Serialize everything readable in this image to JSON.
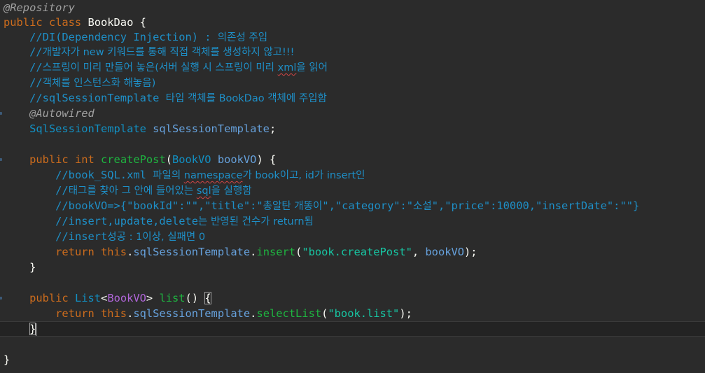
{
  "editor": {
    "lines": [
      {
        "segments": [
          {
            "t": "ann",
            "v": "@Repository"
          }
        ]
      },
      {
        "segments": [
          {
            "t": "kw",
            "v": "public class "
          },
          {
            "t": "plain",
            "v": "BookDao {"
          }
        ]
      },
      {
        "segments": [
          {
            "t": "sp",
            "v": "    "
          },
          {
            "t": "cm",
            "v": "//DI(Dependency Injection) : "
          },
          {
            "t": "cmk",
            "v": "의존성 주입"
          }
        ]
      },
      {
        "segments": [
          {
            "t": "sp",
            "v": "    "
          },
          {
            "t": "cm",
            "v": "//"
          },
          {
            "t": "cmk",
            "v": "개발자가 new 키워드를 통해 직접 객체를 생성하지 않고!!!"
          }
        ]
      },
      {
        "segments": [
          {
            "t": "sp",
            "v": "    "
          },
          {
            "t": "cm",
            "v": "//"
          },
          {
            "t": "cmk",
            "v": "스프링이 미리 만들어 놓은(서버 실행 시 스프링이 미리 "
          },
          {
            "t": "cmk-squig",
            "v": "xml"
          },
          {
            "t": "cmk",
            "v": "을 읽어"
          }
        ]
      },
      {
        "segments": [
          {
            "t": "sp",
            "v": "    "
          },
          {
            "t": "cm",
            "v": "//"
          },
          {
            "t": "cmk",
            "v": "객체를 인스턴스화 해놓음)"
          }
        ]
      },
      {
        "segments": [
          {
            "t": "sp",
            "v": "    "
          },
          {
            "t": "cm",
            "v": "//sqlSessionTemplate "
          },
          {
            "t": "cmk",
            "v": "타입 객체를 BookDao 객체에 주입함"
          }
        ]
      },
      {
        "segments": [
          {
            "t": "sp",
            "v": "    "
          },
          {
            "t": "ann",
            "v": "@Autowired"
          }
        ]
      },
      {
        "segments": [
          {
            "t": "sp",
            "v": "    "
          },
          {
            "t": "type",
            "v": "SqlSessionTemplate "
          },
          {
            "t": "var",
            "v": "sqlSessionTemplate"
          },
          {
            "t": "plain",
            "v": ";"
          }
        ]
      },
      {
        "segments": []
      },
      {
        "segments": [
          {
            "t": "sp",
            "v": "    "
          },
          {
            "t": "kw",
            "v": "public int "
          },
          {
            "t": "fn",
            "v": "createPost"
          },
          {
            "t": "plain",
            "v": "("
          },
          {
            "t": "type",
            "v": "BookVO "
          },
          {
            "t": "var",
            "v": "bookVO"
          },
          {
            "t": "plain",
            "v": ") {"
          }
        ]
      },
      {
        "segments": [
          {
            "t": "sp",
            "v": "        "
          },
          {
            "t": "cm",
            "v": "//book_SQL.xml "
          },
          {
            "t": "cmk",
            "v": "파일의 "
          },
          {
            "t": "cmk-squig",
            "v": "namespace"
          },
          {
            "t": "cmk",
            "v": "가 book이고, id가 insert인"
          }
        ]
      },
      {
        "segments": [
          {
            "t": "sp",
            "v": "        "
          },
          {
            "t": "cm",
            "v": "//"
          },
          {
            "t": "cmk",
            "v": "태그를 찾아 그 안에 들어있는 "
          },
          {
            "t": "cmk-squig",
            "v": "sql"
          },
          {
            "t": "cmk",
            "v": "을 실행함"
          }
        ]
      },
      {
        "segments": [
          {
            "t": "sp",
            "v": "        "
          },
          {
            "t": "cm",
            "v": "//bookVO=>{\"bookId\":\"\",\"title\":\""
          },
          {
            "t": "cmk",
            "v": "총알탄 개똥이"
          },
          {
            "t": "cm",
            "v": "\",\"category\":\""
          },
          {
            "t": "cmk",
            "v": "소설"
          },
          {
            "t": "cm",
            "v": "\",\"price\":10000,\"insertDate\":\"\"}"
          }
        ]
      },
      {
        "segments": [
          {
            "t": "sp",
            "v": "        "
          },
          {
            "t": "cm",
            "v": "//insert,update,delete"
          },
          {
            "t": "cmk",
            "v": "는 반영된 건수가 return됨"
          }
        ]
      },
      {
        "segments": [
          {
            "t": "sp",
            "v": "        "
          },
          {
            "t": "cm",
            "v": "//insert"
          },
          {
            "t": "cmk",
            "v": "성공 : 1이상, 실패면 0"
          }
        ]
      },
      {
        "segments": [
          {
            "t": "sp",
            "v": "        "
          },
          {
            "t": "kw",
            "v": "return this"
          },
          {
            "t": "plain",
            "v": "."
          },
          {
            "t": "var",
            "v": "sqlSessionTemplate"
          },
          {
            "t": "plain",
            "v": "."
          },
          {
            "t": "fn",
            "v": "insert"
          },
          {
            "t": "plain",
            "v": "("
          },
          {
            "t": "str",
            "v": "\"book.createPost\""
          },
          {
            "t": "plain",
            "v": ", "
          },
          {
            "t": "var",
            "v": "bookVO"
          },
          {
            "t": "plain",
            "v": ");"
          }
        ]
      },
      {
        "segments": [
          {
            "t": "sp",
            "v": "    "
          },
          {
            "t": "plain",
            "v": "}"
          }
        ]
      },
      {
        "segments": []
      },
      {
        "segments": [
          {
            "t": "sp",
            "v": "    "
          },
          {
            "t": "kw",
            "v": "public "
          },
          {
            "t": "type",
            "v": "List"
          },
          {
            "t": "plain",
            "v": "<"
          },
          {
            "t": "gen",
            "v": "BookVO"
          },
          {
            "t": "plain",
            "v": "> "
          },
          {
            "t": "fn",
            "v": "list"
          },
          {
            "t": "plain",
            "v": "() "
          },
          {
            "t": "bracket",
            "v": "{"
          }
        ]
      },
      {
        "segments": [
          {
            "t": "sp",
            "v": "        "
          },
          {
            "t": "kw",
            "v": "return this"
          },
          {
            "t": "plain",
            "v": "."
          },
          {
            "t": "var",
            "v": "sqlSessionTemplate"
          },
          {
            "t": "plain",
            "v": "."
          },
          {
            "t": "fn",
            "v": "selectList"
          },
          {
            "t": "plain",
            "v": "("
          },
          {
            "t": "str",
            "v": "\"book.list\""
          },
          {
            "t": "plain",
            "v": ");"
          }
        ]
      },
      {
        "segments": [
          {
            "t": "sp",
            "v": "    "
          },
          {
            "t": "bracket",
            "v": "}"
          },
          {
            "t": "caret",
            "v": ""
          }
        ],
        "current": true
      },
      {
        "segments": []
      },
      {
        "segments": [
          {
            "t": "plain",
            "v": "}"
          }
        ]
      }
    ],
    "colors": {
      "background": "#2b2b2b",
      "keyword": "#cc6c1d",
      "comment": "#1e8fc7",
      "string": "#17c6a3",
      "method": "#1eb540",
      "field": "#66a1dc",
      "type": "#1290c3",
      "generic": "#b166da",
      "annotation": "#a0a0a0"
    }
  }
}
